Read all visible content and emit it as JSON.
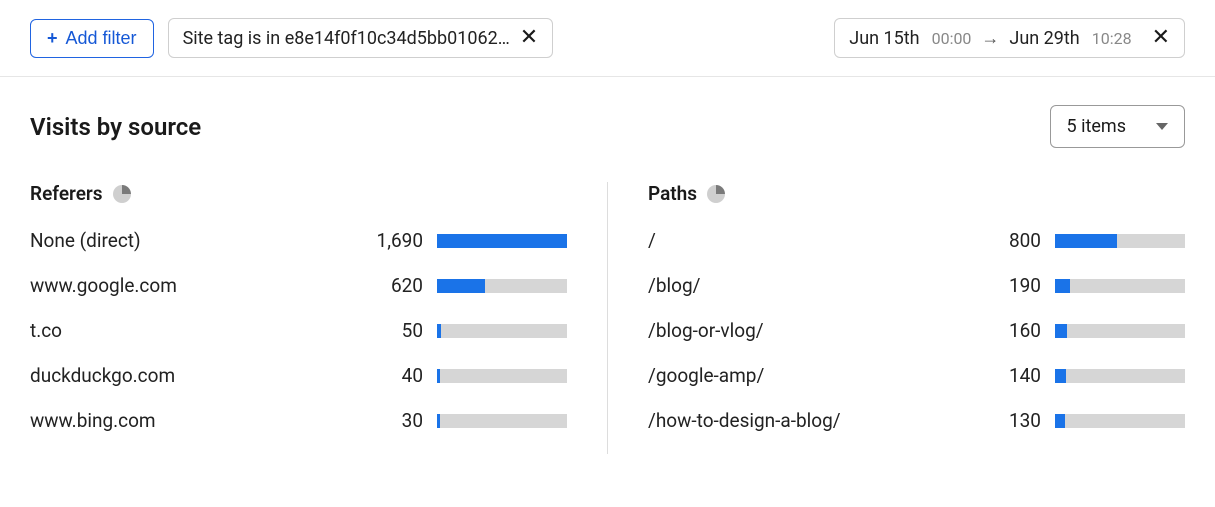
{
  "toolbar": {
    "add_filter_label": "Add filter",
    "filter_chip_text": "Site tag is in e8e14f0f10c34d5bb01062…",
    "date_start": "Jun 15th",
    "date_start_time": "00:00",
    "date_end": "Jun 29th",
    "date_end_time": "10:28"
  },
  "section": {
    "title": "Visits by source",
    "items_select_label": "5 items"
  },
  "referers": {
    "title": "Referers",
    "max": 1690,
    "rows": [
      {
        "name": "None (direct)",
        "value": "1,690",
        "num": 1690
      },
      {
        "name": "www.google.com",
        "value": "620",
        "num": 620
      },
      {
        "name": "t.co",
        "value": "50",
        "num": 50
      },
      {
        "name": "duckduckgo.com",
        "value": "40",
        "num": 40
      },
      {
        "name": "www.bing.com",
        "value": "30",
        "num": 30
      }
    ]
  },
  "paths": {
    "title": "Paths",
    "max": 1690,
    "rows": [
      {
        "name": "/",
        "value": "800",
        "num": 800
      },
      {
        "name": "/blog/",
        "value": "190",
        "num": 190
      },
      {
        "name": "/blog-or-vlog/",
        "value": "160",
        "num": 160
      },
      {
        "name": "/google-amp/",
        "value": "140",
        "num": 140
      },
      {
        "name": "/how-to-design-a-blog/",
        "value": "130",
        "num": 130
      }
    ]
  },
  "chart_data": [
    {
      "type": "bar",
      "title": "Referers",
      "categories": [
        "None (direct)",
        "www.google.com",
        "t.co",
        "duckduckgo.com",
        "www.bing.com"
      ],
      "values": [
        1690,
        620,
        50,
        40,
        30
      ],
      "xlabel": "",
      "ylabel": "",
      "ylim": [
        0,
        1690
      ]
    },
    {
      "type": "bar",
      "title": "Paths",
      "categories": [
        "/",
        "/blog/",
        "/blog-or-vlog/",
        "/google-amp/",
        "/how-to-design-a-blog/"
      ],
      "values": [
        800,
        190,
        160,
        140,
        130
      ],
      "xlabel": "",
      "ylabel": "",
      "ylim": [
        0,
        1690
      ]
    }
  ]
}
